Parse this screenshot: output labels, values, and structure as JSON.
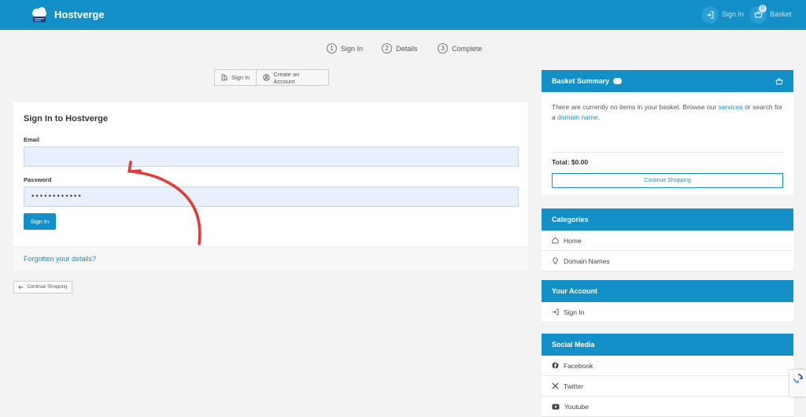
{
  "header": {
    "brand": "Hostverge",
    "signin_label": "Sign In",
    "basket_label": "Basket",
    "basket_count": "0"
  },
  "steps": [
    {
      "num": "1",
      "label": "Sign In"
    },
    {
      "num": "2",
      "label": "Details"
    },
    {
      "num": "3",
      "label": "Complete"
    }
  ],
  "segment": {
    "signin": "Sign In",
    "create": "Create an Account"
  },
  "login": {
    "title": "Sign In to Hostverge",
    "email_label": "Email",
    "email_value": "",
    "password_label": "Password",
    "password_value": "••••••••••••",
    "submit": "Sign In",
    "forgot": "Forgotten your details?",
    "continue": "Continue Shopping"
  },
  "basket": {
    "title": "Basket Summary",
    "text_before": "There are currently no items in your basket. Browse our ",
    "services_link": "services",
    "text_middle": " or search for a ",
    "domain_link": "domain name",
    "text_end": ".",
    "total": "Total: $0.00",
    "continue": "Continue Shopping"
  },
  "categories": {
    "title": "Categories",
    "items": [
      "Home",
      "Domain Names"
    ]
  },
  "account": {
    "title": "Your Account",
    "items": [
      "Sign In"
    ]
  },
  "social": {
    "title": "Social Media",
    "items": [
      "Facebook",
      "Twitter",
      "Youtube"
    ]
  },
  "colors": {
    "accent": "#1490c8",
    "arrow": "#e53935",
    "field_bg": "#e8f0fe"
  }
}
